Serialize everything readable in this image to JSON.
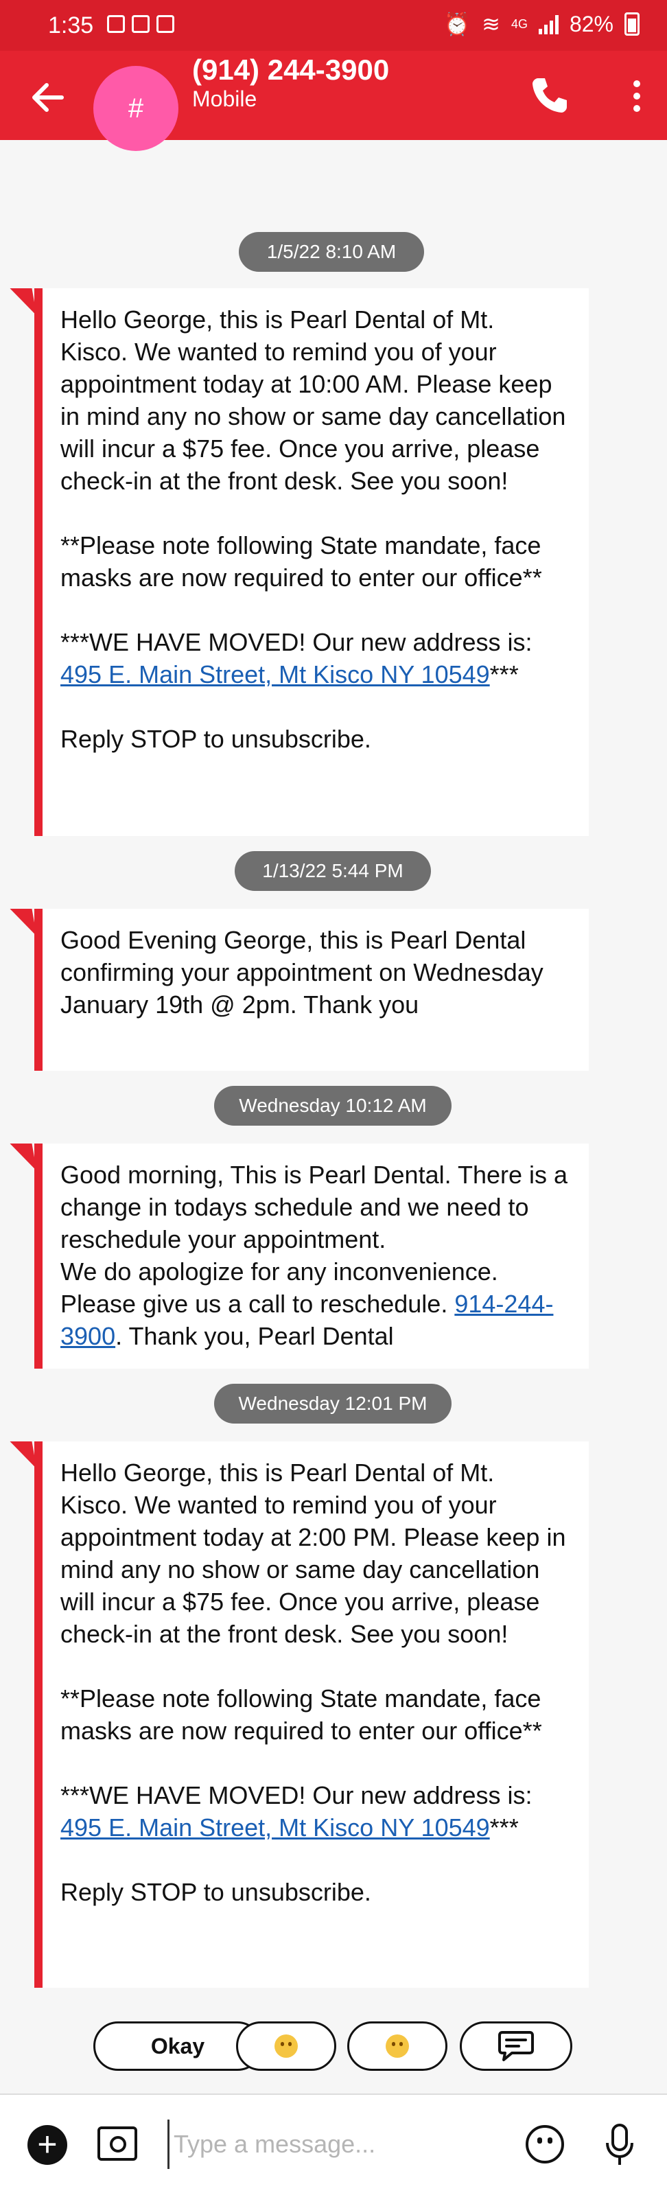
{
  "status_bar": {
    "time": "1:35",
    "network": "4G",
    "battery": "82%"
  },
  "header": {
    "avatar_initial": "#",
    "contact": "(914) 244-3900",
    "label": "Mobile"
  },
  "conversation": {
    "timestamps": [
      "1/5/22 8:10 AM",
      "1/13/22 5:44 PM",
      "Wednesday 10:12 AM",
      "Wednesday 12:01 PM"
    ],
    "messages": [
      {
        "p1": "Hello George, this is Pearl Dental of Mt. Kisco. We wanted to remind you of your appointment today at 10:00 AM. Please keep in mind any no show or same day cancellation will incur a $75 fee. Once you arrive, please check-in at the front desk. See you soon!",
        "p2": "**Please note following State mandate, face masks are now required to enter our office**",
        "p3_prefix": "***WE HAVE MOVED! Our new address is: ",
        "p3_link": "495 E. Main Street, Mt Kisco NY 10549",
        "p3_suffix": "***",
        "p4": "Reply STOP to unsubscribe."
      },
      {
        "text": "Good Evening George, this is Pearl Dental confirming your appointment on Wednesday January 19th @ 2pm. Thank you"
      },
      {
        "text": "Good morning, This is Pearl Dental. There is a change in todays schedule and we need to reschedule your appointment.\nWe do apologize for any inconvenience. Please give us a call to reschedule. ",
        "link": "914-244-3900",
        "suffix": ". Thank you, Pearl Dental"
      },
      {
        "p1": "Hello George, this is Pearl Dental of Mt. Kisco. We wanted to remind you of your appointment today at 2:00 PM. Please keep in mind any no show or same day cancellation will incur a $75 fee. Once you arrive, please check-in at the front desk. See you soon!",
        "p2": "**Please note following State mandate, face masks are now required to enter our office**",
        "p3_prefix": "***WE HAVE MOVED! Our new address is: ",
        "p3_link": "495 E. Main Street, Mt Kisco NY 10549",
        "p3_suffix": "***",
        "p4": "Reply STOP to unsubscribe."
      }
    ]
  },
  "quick_replies": {
    "okay": "Okay",
    "emoji_1": "smiling-face-icon",
    "emoji_2": "worried-face-icon",
    "smart_reply": "chat-suggestion-icon"
  },
  "composer": {
    "placeholder": "Type a message..."
  },
  "colors": {
    "accent": "#e52330",
    "avatar": "#ff5aa8",
    "timestamp_bg": "#6f6f6f",
    "link": "#1a5fb4"
  }
}
